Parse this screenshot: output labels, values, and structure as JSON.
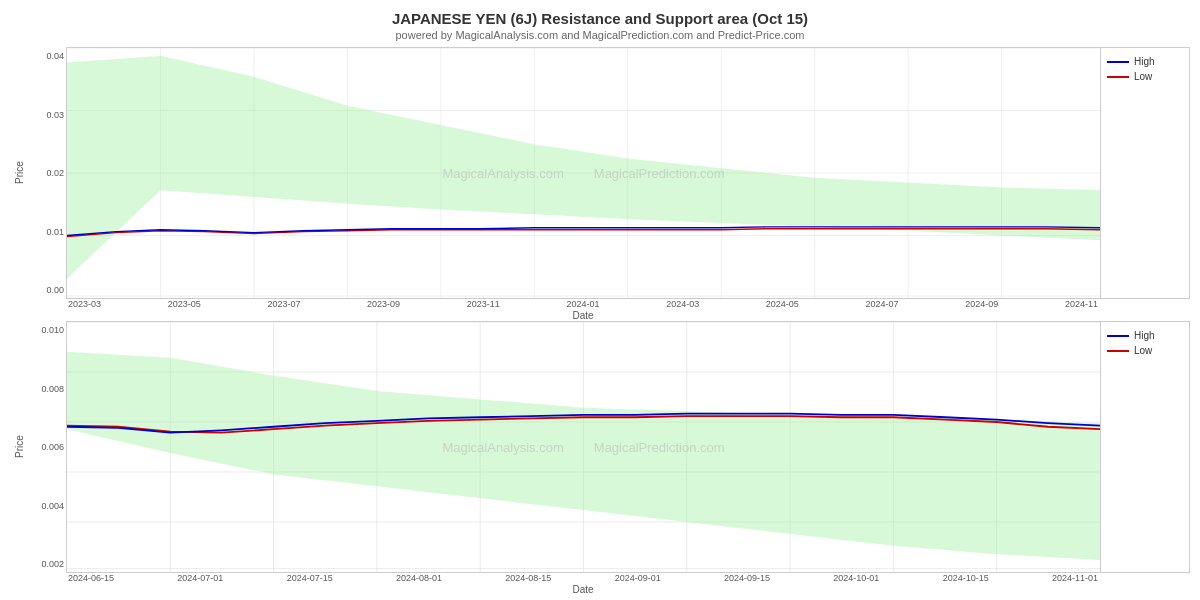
{
  "page": {
    "title": "JAPANESE YEN (6J) Resistance and Support area (Oct 15)",
    "subtitle": "powered by MagicalAnalysis.com and MagicalPrediction.com and Predict-Price.com",
    "y_axis_label": "Price",
    "x_axis_label": "Date"
  },
  "legend": {
    "high_label": "High",
    "low_label": "Low",
    "high_color": "#0000cc",
    "low_color": "#cc0000"
  },
  "chart1": {
    "x_labels": [
      "2023-03",
      "2023-05",
      "2023-07",
      "2023-09",
      "2023-11",
      "2024-01",
      "2024-03",
      "2024-05",
      "2024-07",
      "2024-09",
      "2024-11"
    ],
    "y_labels": [
      "0.04",
      "0.03",
      "0.02",
      "0.01",
      "0.00"
    ],
    "watermark1": "MagicalAnalysis.com",
    "watermark2": "MagicalPrediction.com"
  },
  "chart2": {
    "x_labels": [
      "2024-06-15",
      "2024-07-01",
      "2024-07-15",
      "2024-08-01",
      "2024-08-15",
      "2024-09-01",
      "2024-09-15",
      "2024-10-01",
      "2024-10-15",
      "2024-11-01"
    ],
    "y_labels": [
      "0.010",
      "0.008",
      "0.006",
      "0.004",
      "0.002"
    ],
    "watermark1": "MagicalAnalysis.com",
    "watermark2": "MagicalPrediction.com"
  }
}
